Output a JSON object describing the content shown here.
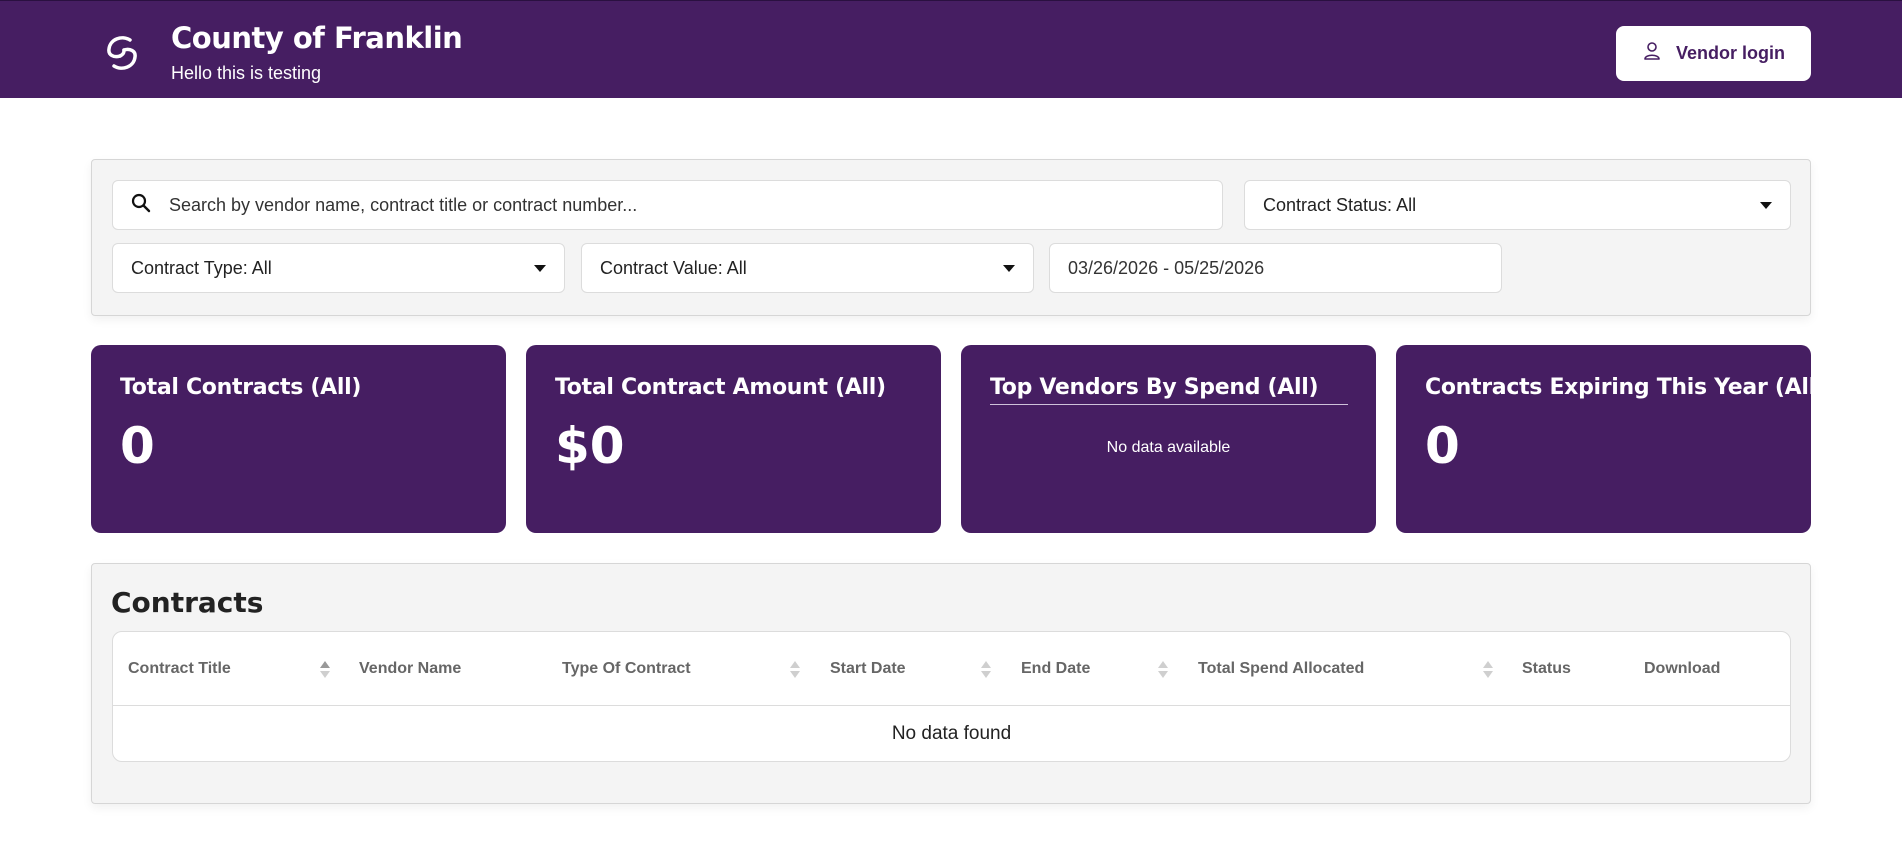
{
  "header": {
    "org_name": "County of Franklin",
    "org_subtitle": "Hello this is testing",
    "vendor_login_label": "Vendor login",
    "brand_color": "#461e62"
  },
  "filters": {
    "search_placeholder": "Search by vendor name, contract title or contract number...",
    "contract_status": "Contract Status: All",
    "contract_type": "Contract Type: All",
    "contract_value": "Contract Value: All",
    "date_range": "03/26/2026 - 05/25/2026"
  },
  "cards": [
    {
      "title": "Total Contracts (All)",
      "value": "0"
    },
    {
      "title": "Total Contract Amount (All)",
      "value": "$0"
    },
    {
      "title": "Top Vendors By Spend (All)",
      "empty_text": "No data available"
    },
    {
      "title": "Contracts Expiring This Year (All)",
      "value": "0"
    }
  ],
  "contracts": {
    "heading": "Contracts",
    "columns": [
      "Contract Title",
      "Vendor Name",
      "Type Of Contract",
      "Start Date",
      "End Date",
      "Total Spend Allocated",
      "Status",
      "Download"
    ],
    "empty_text": "No data found"
  }
}
